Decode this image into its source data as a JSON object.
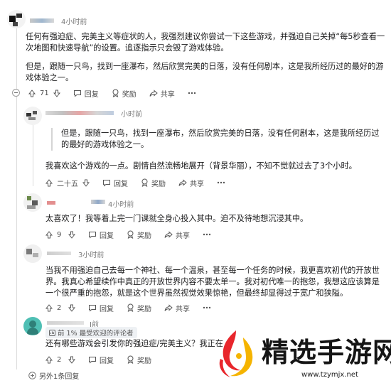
{
  "comments": [
    {
      "time": "4小时前",
      "paragraphs": [
        "任何有强迫症、完美主义等症状的人，我强烈建议你尝试一下这些游戏，并强迫自己关掉“每5秒查看一次地图和快速导航”的设置。追逐指示只会毁了游戏体验。",
        "但是，跟随一只鸟，找到一座瀑布，然后欣赏完美的日落，没有任何剧本，这是我所经历过的最好的游戏体验之一。"
      ],
      "votes": "71",
      "reply_label": "回复",
      "award_label": "奖励",
      "share_label": "共享"
    },
    {
      "time": "小时前",
      "quote": "但是，跟随一只鸟，找到一座瀑布，然后欣赏完美的日落，没有任何剧本，这是我所经历过的最好的游戏体验之一。",
      "text": "我喜欢这个游戏的一点。剧情自然流畅地展开（背景华丽），不知不觉就过去了3个小时。",
      "votes": "二十五",
      "reply_label": "回复",
      "award_label": "奖励",
      "share_label": "共享"
    },
    {
      "time": "4小时前",
      "text": "太喜欢了！我等着上完一门课就全身心投入其中。迫不及待地想沉浸其中。",
      "votes": "9",
      "reply_label": "回复",
      "award_label": "奖励",
      "share_label": "共享"
    },
    {
      "time": "3小时前",
      "text": "当我不用强迫自己去每一个神社、每一个温泉，甚至每一个任务的时候，我更喜欢初代的开放世界。我真心希望续作中真正的开放世界内容不要太单一。我对初代唯一的抱怨，我想这应该算是一个很严重的抱怨，就是这个世界虽然视觉效果惊艳，但最终却显得过于宽广和狭隘。",
      "votes": "2",
      "reply_label": "回复",
      "award_label": "奖励",
      "share_label": "共享"
    },
    {
      "time": "J前",
      "badge": "前 1% 最受欢迎的评论者",
      "text": "还有哪些游戏会引发你的强迫症/完美主义？我正在扌",
      "votes": "2",
      "reply_label": "回复",
      "award_label": "奖励"
    }
  ],
  "more_replies": "另外1条回复",
  "watermark": {
    "title": "精选手游网",
    "url": "www.tzymjx.net"
  },
  "colors": {
    "text": "#1a1a1b",
    "meta": "#7c7c7c",
    "thread_line": "#dcdcdc",
    "teal_avatar": "#4fbfb4",
    "watermark_red": "#e8262c",
    "watermark_yellow": "#f5b400"
  }
}
